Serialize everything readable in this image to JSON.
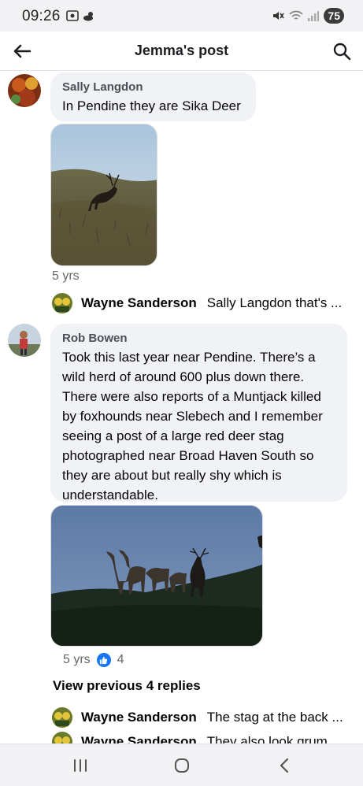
{
  "status_bar": {
    "time": "09:26",
    "battery": "75"
  },
  "header": {
    "title": "Jemma's post"
  },
  "comments": [
    {
      "author": "Sally Langdon",
      "text": "In Pendine they are Sika Deer",
      "time": "5 yrs"
    },
    {
      "author": "Rob Bowen",
      "text": "Took this last year near Pendine. There’s a wild herd of around 600 plus down there. There were also reports of a Muntjack killed by foxhounds near Slebech and I remember seeing a post of a large red deer stag photographed near Broad Haven South so they are about but really shy which is understandable.",
      "time": "5 yrs",
      "likes": "4"
    }
  ],
  "replies": [
    {
      "author": "Wayne Sanderson",
      "text": "Sally Langdon that's ..."
    },
    {
      "author": "Wayne Sanderson",
      "text": "The stag at the back ..."
    },
    {
      "author": "Wayne Sanderson",
      "text": "They also look grum..."
    }
  ],
  "view_previous": "View previous 4 replies",
  "colors": {
    "like_blue": "#1877f2",
    "bubble_bg": "#f0f2f5",
    "meta_gray": "#65676b"
  }
}
